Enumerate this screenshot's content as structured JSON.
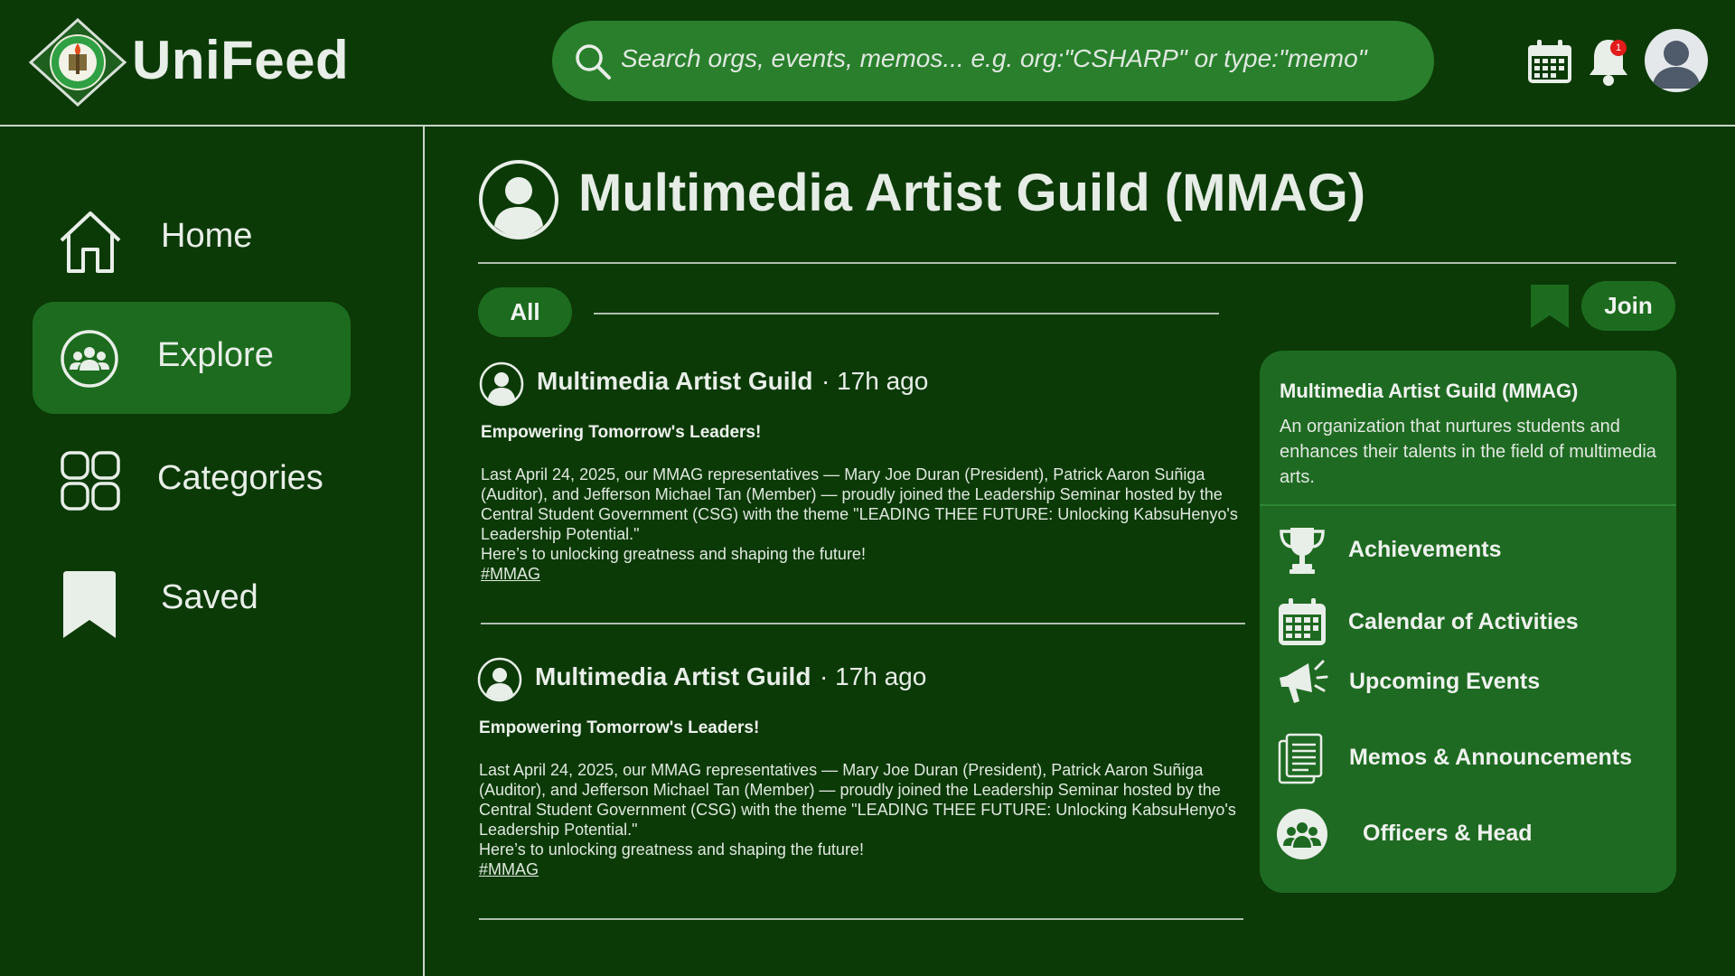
{
  "app": {
    "name": "UniFeed",
    "search_placeholder": "Search orgs, events, memos... e.g. org:\"CSHARP\" or type:\"memo\"",
    "notification_count": "1"
  },
  "sidebar": {
    "items": [
      {
        "label": "Home",
        "icon": "home-icon",
        "active": false
      },
      {
        "label": "Explore",
        "icon": "group-icon",
        "active": true
      },
      {
        "label": "Categories",
        "icon": "grid-icon",
        "active": false
      },
      {
        "label": "Saved",
        "icon": "bookmark-icon",
        "active": false
      }
    ]
  },
  "org": {
    "title": "Multimedia Artist Guild (MMAG)",
    "filter_label": "All",
    "join_label": "Join"
  },
  "posts": [
    {
      "author": "Multimedia Artist Guild",
      "time": "17h ago",
      "headline": "Empowering Tomorrow's Leaders!",
      "body": "Last April 24, 2025, our MMAG representatives — Mary Joe Duran (President), Patrick Aaron Suñiga (Auditor), and Jefferson Michael Tan (Member) — proudly joined the Leadership Seminar hosted by the Central Student Government (CSG) with the theme \"LEADING THEE FUTURE: Unlocking KabsuHenyo's Leadership Potential.\"",
      "closing": "Here’s to unlocking greatness and shaping the future!",
      "hashtag": "#MMAG"
    },
    {
      "author": "Multimedia Artist Guild",
      "time": "17h ago",
      "headline": "Empowering Tomorrow's Leaders!",
      "body": "Last April 24, 2025, our MMAG representatives — Mary Joe Duran (President), Patrick Aaron Suñiga (Auditor), and Jefferson Michael Tan (Member) — proudly joined the Leadership Seminar hosted by the Central Student Government (CSG) with the theme \"LEADING THEE FUTURE: Unlocking KabsuHenyo's Leadership Potential.\"",
      "closing": "Here’s to unlocking greatness and shaping the future!",
      "hashtag": "#MMAG"
    }
  ],
  "info_card": {
    "title": "Multimedia Artist Guild (MMAG)",
    "description": "An organization that nurtures students and enhances their talents in the field of multimedia arts.",
    "links": [
      {
        "label": "Achievements",
        "icon": "trophy-icon"
      },
      {
        "label": "Calendar of Activities",
        "icon": "calendar-icon"
      },
      {
        "label": "Upcoming Events",
        "icon": "megaphone-icon"
      },
      {
        "label": "Memos & Announcements",
        "icon": "memo-icon"
      },
      {
        "label": "Officers & Head",
        "icon": "officers-icon"
      }
    ]
  },
  "colors": {
    "background": "#0b3a06",
    "panel": "#1f6a22",
    "accent": "#1d6b1f",
    "search": "#2a7f2d",
    "text": "#e6ece6",
    "badge": "#e21b1b"
  }
}
